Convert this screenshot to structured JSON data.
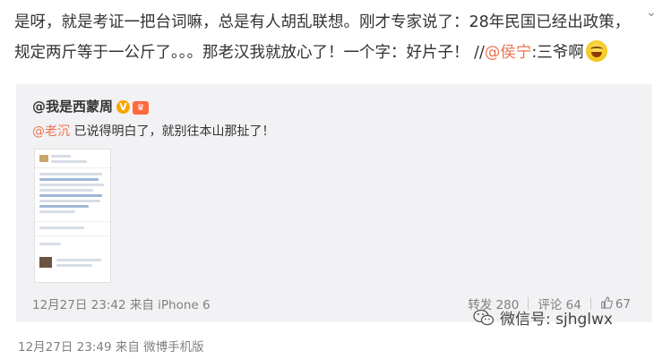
{
  "post": {
    "text_line1": "是呀，就是考证一把台词嘛，总是有人胡乱联想。刚才专家说了：28年民国已经出政策，",
    "text_line2_a": "规定两斤等于一公斤了。。。那老汉我就放心了！一个字：好片子！ //",
    "mention": "@侯宁",
    "text_line2_b": ":三爷啊",
    "emoji": "laughing-emoji",
    "meta": "12月27日 23:49 来自 微博手机版"
  },
  "repost": {
    "author": "@我是西蒙周",
    "verified_badge": "V",
    "mention": "@老沉",
    "text": " 已说得明白了，就别往本山那扯了！",
    "meta": "12月27日 23:42 来自 iPhone 6",
    "actions": {
      "forward": "转发 280",
      "comment": "评论 64",
      "likes": "67"
    }
  },
  "watermark": {
    "label": "微信号: sjhglwx"
  }
}
